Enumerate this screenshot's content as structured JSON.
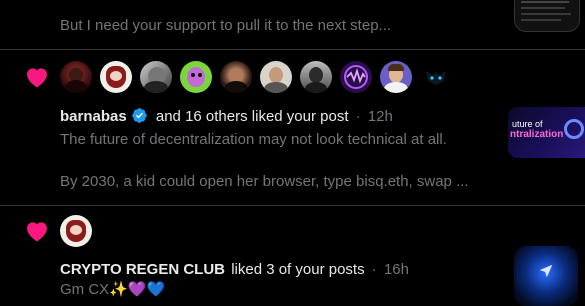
{
  "notifications": [
    {
      "preview_text": "But I need your support to pull it to the next step..."
    },
    {
      "actor": "barnabas",
      "action_text": "and 16 others liked your post",
      "separator": "·",
      "time": "12h",
      "post_line_1": "The future of decentralization may not look technical at all.",
      "post_line_2": "By 2030, a kid could open her browser, type bisq.eth, swap ...",
      "thumbnail_text_1": "uture of",
      "thumbnail_text_2": "ntralization"
    },
    {
      "actor": "CRYPTO REGEN CLUB",
      "action_text": "liked 3 of your posts",
      "separator": "·",
      "time": "16h",
      "post_line_1": "Gm CX✨💜💙"
    }
  ],
  "colors": {
    "heart": "#f91880",
    "verified": "#1d9bf0",
    "muted": "#71767b",
    "divider": "#2f3336"
  }
}
